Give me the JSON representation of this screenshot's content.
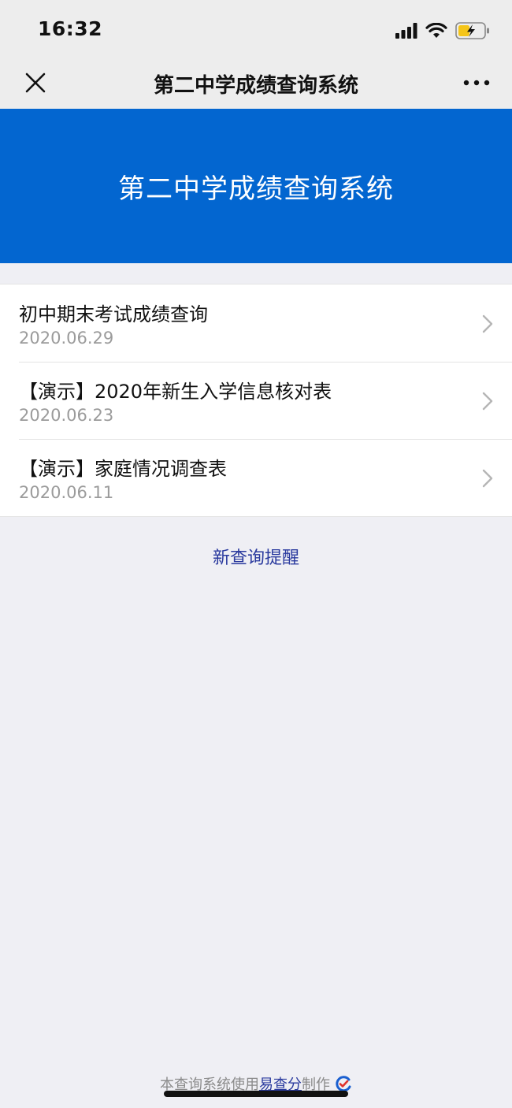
{
  "status_bar": {
    "time": "16:32"
  },
  "nav": {
    "title": "第二中学成绩查询系统"
  },
  "banner": {
    "title": "第二中学成绩查询系统",
    "color": "#0366d0"
  },
  "list": [
    {
      "title": "初中期末考试成绩查询",
      "date": "2020.06.29"
    },
    {
      "title": "【演示】2020年新生入学信息核对表",
      "date": "2020.06.23"
    },
    {
      "title": "【演示】家庭情况调查表",
      "date": "2020.06.11"
    }
  ],
  "reminder_link": "新查询提醒",
  "footer": {
    "prefix": "本查询系统使用",
    "link": "易查分",
    "suffix": "制作"
  },
  "colors": {
    "link": "#2a3a9e",
    "battery": "#f5c518"
  }
}
